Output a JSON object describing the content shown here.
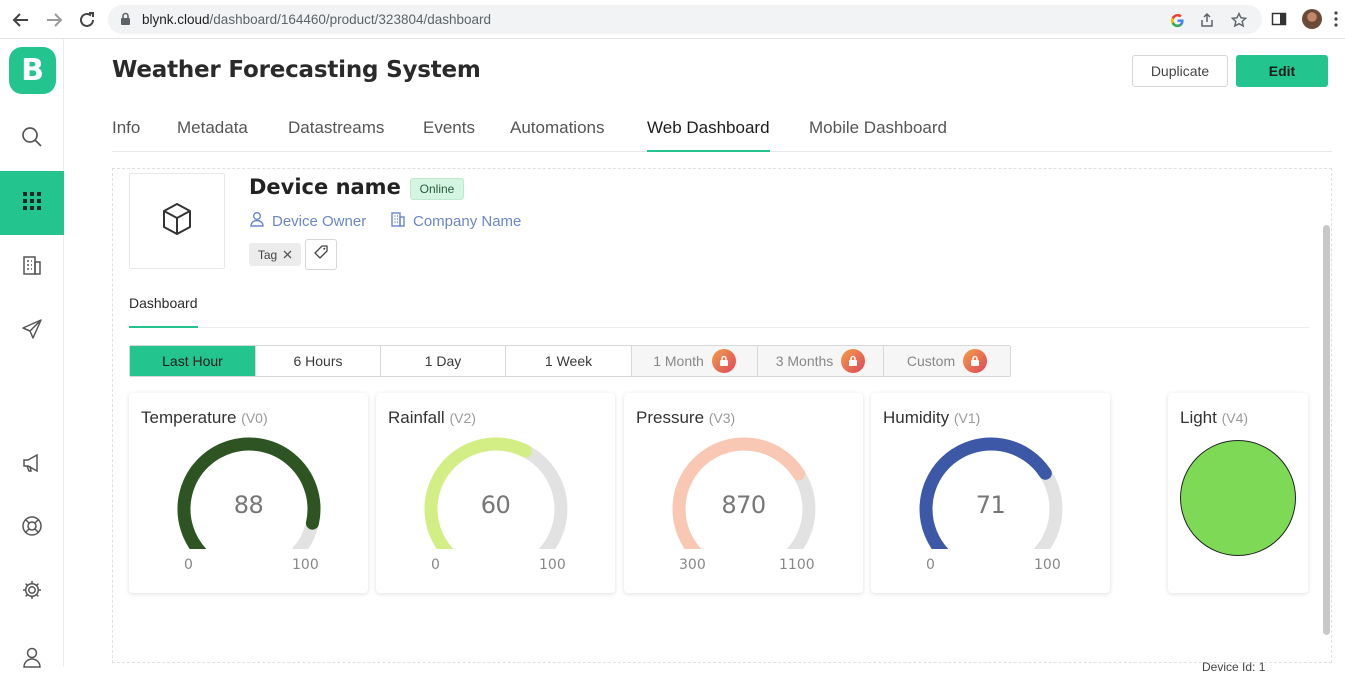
{
  "browser": {
    "url_host": "blynk.cloud",
    "url_path": "/dashboard/164460/product/323804/dashboard"
  },
  "sidebar": {
    "logo_letter": "B",
    "items": [
      {
        "icon": "search-icon"
      },
      {
        "icon": "grid-icon",
        "active": true
      },
      {
        "icon": "building-icon"
      },
      {
        "icon": "send-icon"
      },
      {
        "icon": "megaphone-icon"
      },
      {
        "icon": "lifebuoy-icon"
      },
      {
        "icon": "gear-icon"
      },
      {
        "icon": "user-badge-icon"
      }
    ]
  },
  "header": {
    "title": "Weather Forecasting System",
    "duplicate_label": "Duplicate",
    "edit_label": "Edit"
  },
  "tabs": [
    "Info",
    "Metadata",
    "Datastreams",
    "Events",
    "Automations",
    "Web Dashboard",
    "Mobile Dashboard"
  ],
  "active_tab": "Web Dashboard",
  "device": {
    "name": "Device name",
    "status": "Online",
    "owner": "Device Owner",
    "company": "Company Name",
    "tag": "Tag"
  },
  "subtab": "Dashboard",
  "time_ranges": [
    {
      "label": "Last Hour",
      "active": true,
      "locked": false
    },
    {
      "label": "6 Hours",
      "active": false,
      "locked": false
    },
    {
      "label": "1 Day",
      "active": false,
      "locked": false
    },
    {
      "label": "1 Week",
      "active": false,
      "locked": false
    },
    {
      "label": "1 Month",
      "active": false,
      "locked": true
    },
    {
      "label": "3 Months",
      "active": false,
      "locked": true
    },
    {
      "label": "Custom",
      "active": false,
      "locked": true
    }
  ],
  "widgets": [
    {
      "title": "Temperature",
      "pin": "(V0)",
      "value": "88",
      "min": "0",
      "max": "100",
      "fraction": 0.88,
      "color": "#2e5424"
    },
    {
      "title": "Rainfall",
      "pin": "(V2)",
      "value": "60",
      "min": "0",
      "max": "100",
      "fraction": 0.6,
      "color": "#d4ee86"
    },
    {
      "title": "Pressure",
      "pin": "(V3)",
      "value": "870",
      "min": "300",
      "max": "1100",
      "fraction": 0.7125,
      "color": "#f9c8b4"
    },
    {
      "title": "Humidity",
      "pin": "(V1)",
      "value": "71",
      "min": "0",
      "max": "100",
      "fraction": 0.71,
      "color": "#3e58a8"
    }
  ],
  "light": {
    "title": "Light",
    "pin": "(V4)",
    "color": "#7ed957"
  },
  "footer": "Device Id: 1"
}
